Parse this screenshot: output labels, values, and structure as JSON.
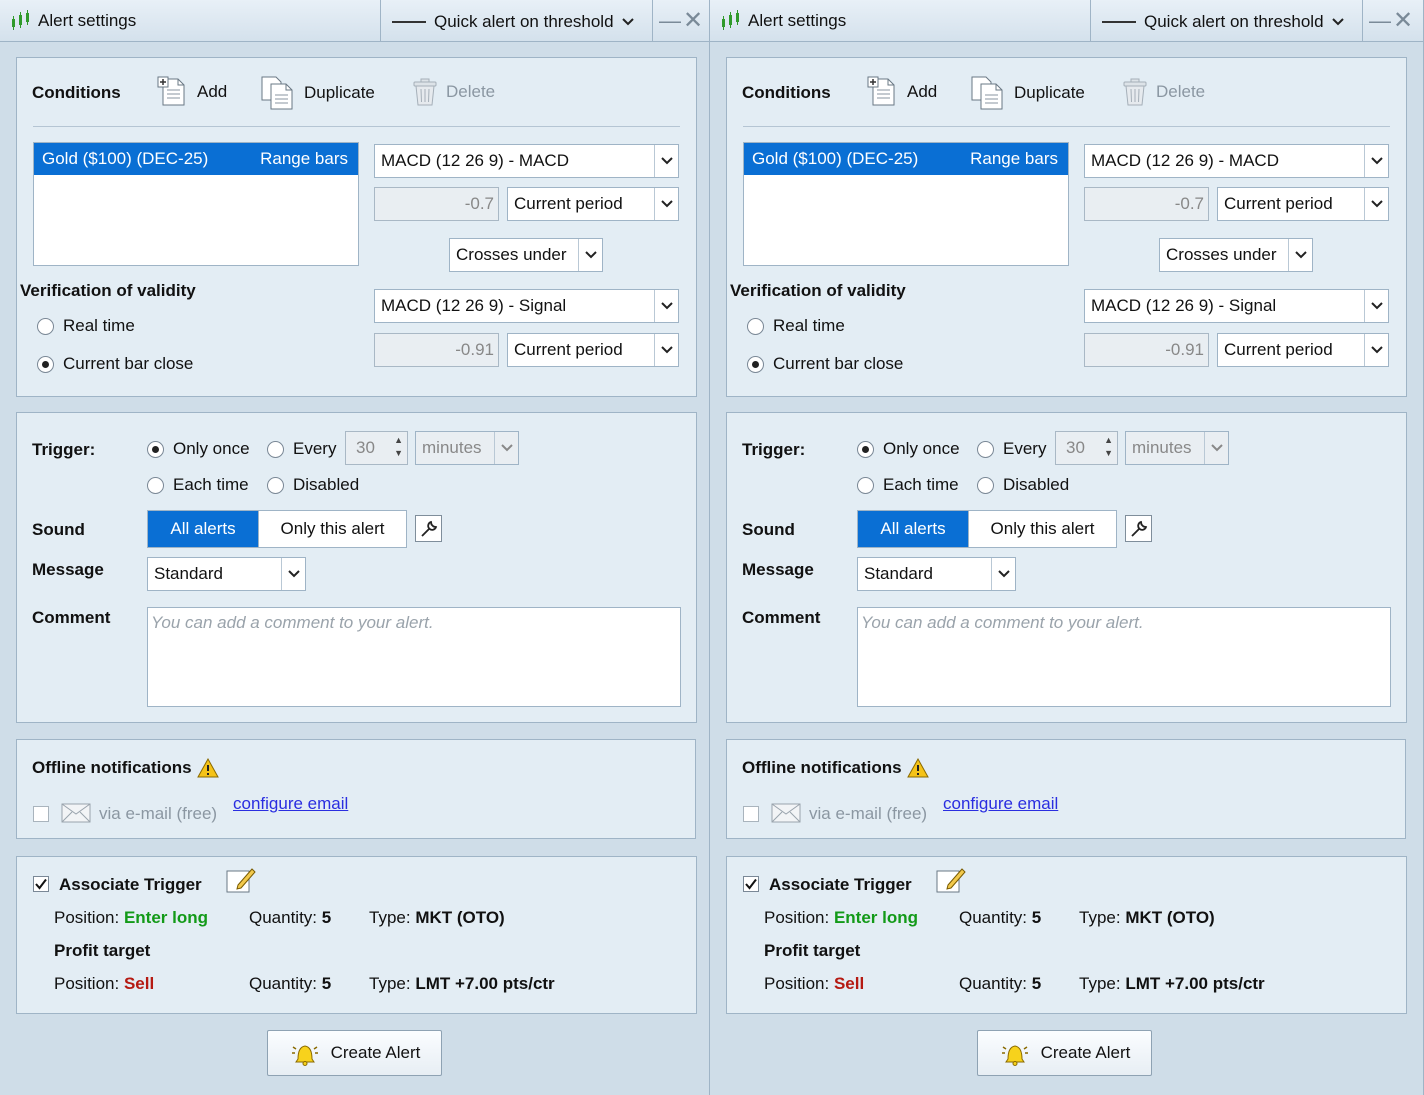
{
  "title": "Alert settings",
  "quick_alert_label": "Quick alert on threshold",
  "conditions": {
    "header": "Conditions",
    "add": "Add",
    "duplicate": "Duplicate",
    "delete": "Delete",
    "instrument": "Gold ($100) (DEC-25)",
    "bar_type": "Range bars",
    "indicator1": "MACD (12 26 9)  - MACD",
    "value1": "-0.7",
    "period1": "Current period",
    "operator": "Crosses under",
    "indicator2": "MACD (12 26 9)  - Signal",
    "value2": "-0.91",
    "period2": "Current period",
    "verification_header": "Verification of validity",
    "real_time": "Real time",
    "current_bar_close": "Current bar close",
    "selected_verification": "current_bar_close"
  },
  "trigger": {
    "label": "Trigger:",
    "only_once": "Only once",
    "every": "Every",
    "every_value": "30",
    "every_unit": "minutes",
    "each_time": "Each time",
    "disabled": "Disabled",
    "selected": "only_once"
  },
  "sound": {
    "label": "Sound",
    "all_alerts": "All alerts",
    "only_this_alert": "Only this alert",
    "selected": "all_alerts"
  },
  "message": {
    "label": "Message",
    "value": "Standard"
  },
  "comment": {
    "label": "Comment",
    "placeholder": "You can add a comment to your alert."
  },
  "offline": {
    "header": "Offline notifications",
    "via_email": "via e-mail (free)",
    "configure_email": "configure email",
    "email_checked": false
  },
  "associate": {
    "label": "Associate Trigger",
    "checked": true,
    "position_label": "Position:",
    "entry_position": "Enter long",
    "quantity_label": "Quantity:",
    "entry_quantity": "5",
    "type_label": "Type:",
    "entry_type": "MKT  (OTO)",
    "profit_target": "Profit target",
    "exit_position": "Sell",
    "exit_quantity": "5",
    "exit_type": "LMT +7.00 pts/ctr"
  },
  "create_alert": "Create Alert",
  "colors": {
    "selection_blue": "#0a6fd4",
    "enter_long_green": "#139a18",
    "sell_red": "#b51a12",
    "link_blue": "#2a2ee0"
  }
}
